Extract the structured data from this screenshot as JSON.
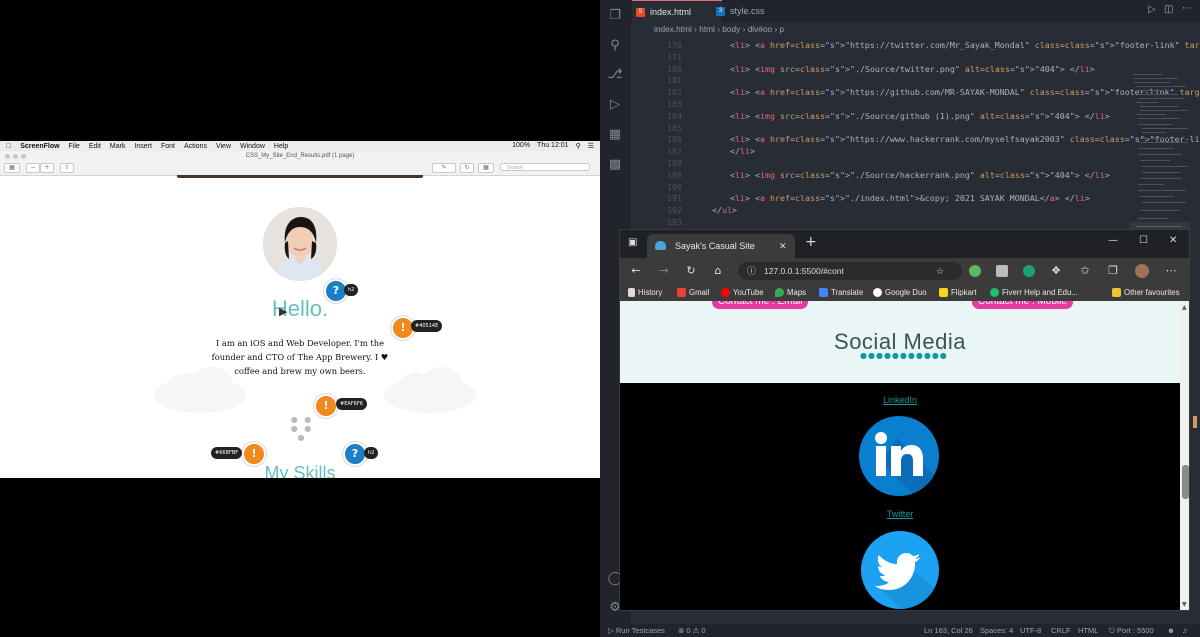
{
  "screenflow": {
    "menubar": {
      "app": "ScreenFlow",
      "items": [
        "File",
        "Edit",
        "Mark",
        "Insert",
        "Font",
        "Actions",
        "View",
        "Window",
        "Help"
      ],
      "clock": "Thu 12:01",
      "battery": "100%"
    },
    "doc_title": "CSS_My_Site_End_Results.pdf (1 page)",
    "search_placeholder": "Search",
    "hello": "Hello.",
    "bio": "I am an iOS and Web Developer. I'm the founder and CTO of The App Brewery. I ♥ coffee and brew my own beers.",
    "skills": "My Skills",
    "annotations": {
      "h2_top": "h2",
      "color_1": "#40514E",
      "color_2": "#EAF6F6",
      "color_3": "#66BFBF",
      "h2_bottom": "h2"
    }
  },
  "vscode": {
    "tabs": [
      {
        "label": "index.html",
        "icon": "html5-icon",
        "active": true
      },
      {
        "label": "style.css",
        "icon": "css3-icon",
        "active": false
      }
    ],
    "breadcrumb": [
      "index.html",
      "html",
      "body",
      "div#oo",
      "p"
    ],
    "lines": [
      {
        "n": "170",
        "html": "<li> <a href=\"https://twitter.com/Mr_Sayak_Mondal\" class=\"footer-link\" target=\"blan"
      },
      {
        "n": "171",
        "html": ""
      },
      {
        "n": "180",
        "html": "<li> <img src=\"./Source/twitter.png\" alt=\"404\"> </li>"
      },
      {
        "n": "181",
        "html": ""
      },
      {
        "n": "182",
        "html": "<li> <a href=\"https://github.com/MR-SAYAK-MONDAL\" class=\"footer-link\" target=\"blank"
      },
      {
        "n": "183",
        "html": ""
      },
      {
        "n": "184",
        "html": "<li> <img src=\"./Source/github (1).png\" alt=\"404\"> </li>"
      },
      {
        "n": "185",
        "html": ""
      },
      {
        "n": "186",
        "html": "<li> <a href=\"https://www.hackerrank.com/myselfsayak2003\" class=\"footer-link\" targe"
      },
      {
        "n": "187",
        "html": "</li>"
      },
      {
        "n": "188",
        "html": ""
      },
      {
        "n": "189",
        "html": "<li> <img src=\"./Source/hackerrank.png\" alt=\"404\"> </li>"
      },
      {
        "n": "190",
        "html": ""
      },
      {
        "n": "191",
        "html": "<li> <a href=\"./index.html\">&copy; 2021 SAYAK MONDAL</a> </li>"
      },
      {
        "n": "192",
        "html": "</ul>"
      },
      {
        "n": "193",
        "html": ""
      }
    ],
    "statusbar": {
      "left": "Run Testcases",
      "problems": "⊗ 0  ⚠ 0",
      "position": "Ln 163, Col 26",
      "spaces": "Spaces: 4",
      "encoding": "UTF-8",
      "eol": "CRLF",
      "language": "HTML",
      "port": "Port : 5500"
    }
  },
  "browser": {
    "tab_title": "Sayak's Casual Site",
    "url": "127.0.0.1:5500/#cont",
    "bookmarks": [
      "History",
      "Gmail",
      "YouTube",
      "Maps",
      "Translate",
      "Google Duo",
      "Flipkart",
      "Fiverr Help and Edu..."
    ],
    "other_favourites": "Other favourites",
    "page": {
      "contact_email": "Contact me : Email",
      "contact_mobile": "Contact me : Mobile",
      "social_title": "Social Media",
      "link_linkedin": "LinkedIn",
      "link_twitter": "Twitter"
    }
  },
  "colors": {
    "accent_teal": "#66bfbf",
    "page_bg_light": "#eaf6f6",
    "heading_dark": "#40514e",
    "button_pink": "#e63ba0",
    "linkedin_blue": "#0a7fd0",
    "twitter_blue": "#1da1f2"
  }
}
